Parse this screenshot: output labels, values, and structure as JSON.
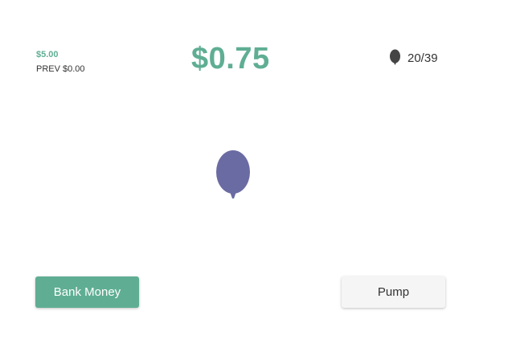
{
  "stats": {
    "total_earned": "$5.00",
    "previous_earned": "PREV $0.00",
    "current_amount": "$0.75",
    "balloon_count": "20/39"
  },
  "icons": {
    "counter_icon": "balloon-icon",
    "main_balloon": "balloon-icon"
  },
  "buttons": {
    "bank_label": "Bank Money",
    "pump_label": "Pump"
  },
  "colors": {
    "accent": "#5fae93",
    "balloon": "#6b6ba3",
    "counter_icon": "#444444",
    "pump_button_bg": "#f5f5f5"
  }
}
